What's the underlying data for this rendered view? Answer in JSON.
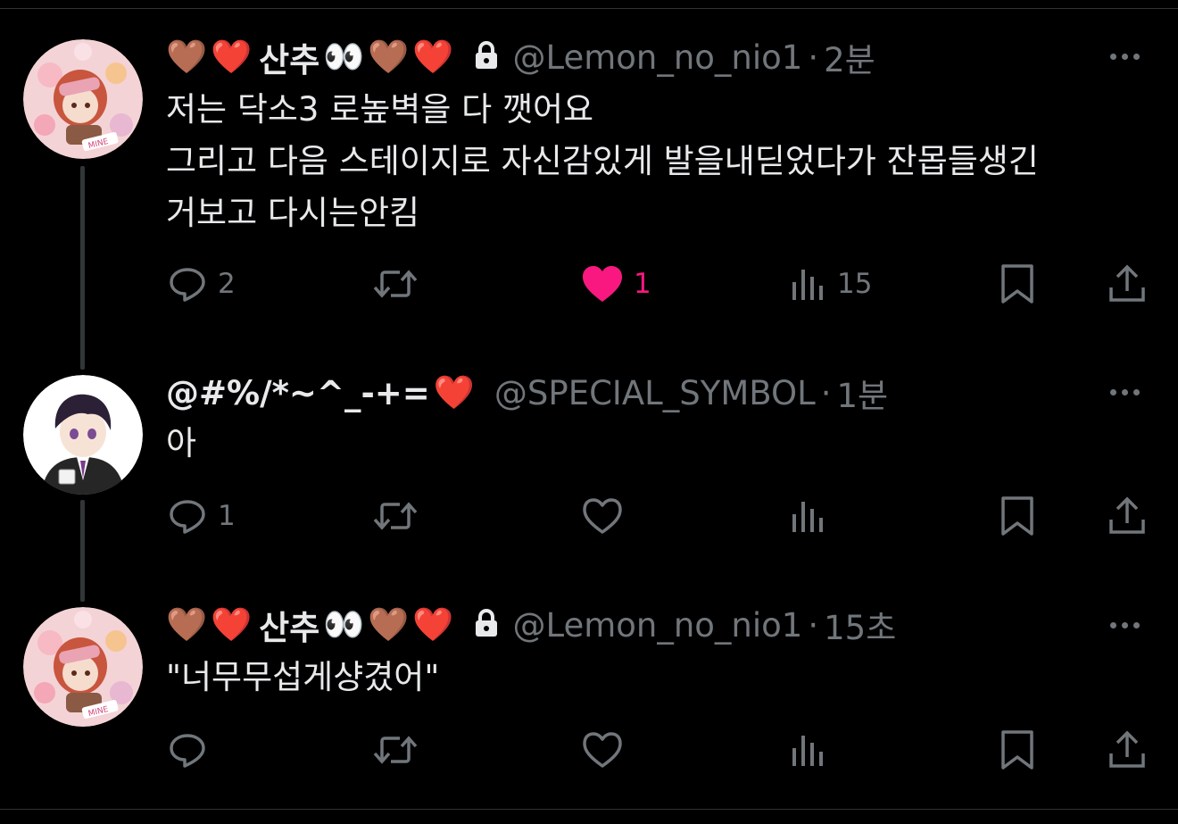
{
  "colors": {
    "background": "#000000",
    "text": "#e7e9ea",
    "muted": "#71767b",
    "like_active": "#f91880",
    "thread_line": "#333639"
  },
  "tweets": [
    {
      "display_name": "산추",
      "name_emojis_before": [
        "🤎",
        "❤️"
      ],
      "name_emojis_after": [
        "👀",
        "🤎",
        "❤️"
      ],
      "locked": true,
      "lock_icon": "lock-icon",
      "handle": "@Lemon_no_nio1",
      "separator": "·",
      "time": "2분",
      "lines": [
        "저는 닥소3 로높벽을 다 깻어요",
        "그리고 다음 스테이지로 자신감있게 발을내딛었다가 잔몹들생긴",
        "거보고 다시는안킴"
      ],
      "replies": "2",
      "retweets": "",
      "likes": "1",
      "liked": true,
      "views": "15"
    },
    {
      "display_name": "@#%/*~^_-+=",
      "name_emojis_before": [],
      "name_emojis_after": [
        "❤️"
      ],
      "locked": false,
      "handle": "@SPECIAL_SYMBOL",
      "separator": "·",
      "time": "1분",
      "lines": [
        "아"
      ],
      "replies": "1",
      "retweets": "",
      "likes": "",
      "liked": false,
      "views": ""
    },
    {
      "display_name": "산추",
      "name_emojis_before": [
        "🤎",
        "❤️"
      ],
      "name_emojis_after": [
        "👀",
        "🤎",
        "❤️"
      ],
      "locked": true,
      "lock_icon": "lock-icon",
      "handle": "@Lemon_no_nio1",
      "separator": "·",
      "time": "15초",
      "lines": [
        "\"너무무섭게샹겼어\""
      ],
      "replies": "",
      "retweets": "",
      "likes": "",
      "liked": false,
      "views": ""
    }
  ],
  "avatar_text": "MINE"
}
